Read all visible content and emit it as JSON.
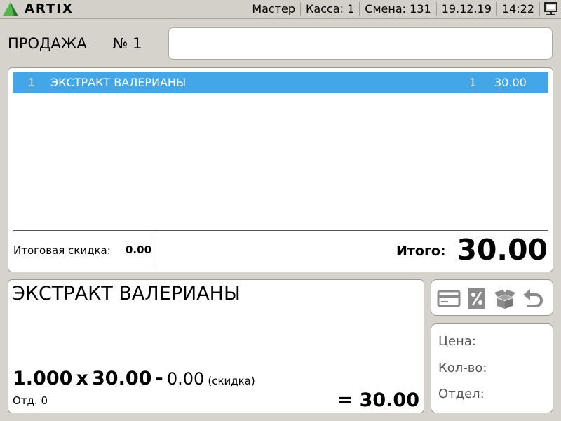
{
  "topbar": {
    "brand": "ARTIX",
    "logo_icon": "artix-triangle-logo",
    "user": "Мастер",
    "kassa": "Касса: 1",
    "shift": "Смена: 131",
    "date": "19.12.19",
    "time": "14:22",
    "monitor_icon": "network-monitor-icon"
  },
  "sale": {
    "label": "ПРОДАЖА",
    "number": "№ 1",
    "search_value": ""
  },
  "receipt": {
    "rows": [
      {
        "no": "1",
        "name": "ЭКСТРАКТ ВАЛЕРИАНЫ",
        "qty": "1",
        "sum": "30.00"
      }
    ],
    "discount_label": "Итоговая скидка:",
    "discount_value": "0.00",
    "total_label": "Итого:",
    "total_value": "30.00"
  },
  "current_item": {
    "name": "ЭКСТРАКТ ВАЛЕРИАНЫ",
    "qty": "1.000",
    "times": "x",
    "price": "30.00",
    "minus": "-",
    "discount": "0.00",
    "discount_note": "(скидка)",
    "dept": "Отд. 0",
    "equals": "=",
    "total": "30.00"
  },
  "tools": [
    "card-payment-icon",
    "discount-percent-icon",
    "open-box-icon",
    "undo-icon"
  ],
  "info": {
    "price_label": "Цена:",
    "qty_label": "Кол-во:",
    "dept_label": "Отдел:"
  },
  "colors": {
    "selected_row": "#43a6e6",
    "background": "#d6d3cc",
    "icon_gray": "#8b8b8b",
    "logo_green": "#2f9a3e"
  }
}
